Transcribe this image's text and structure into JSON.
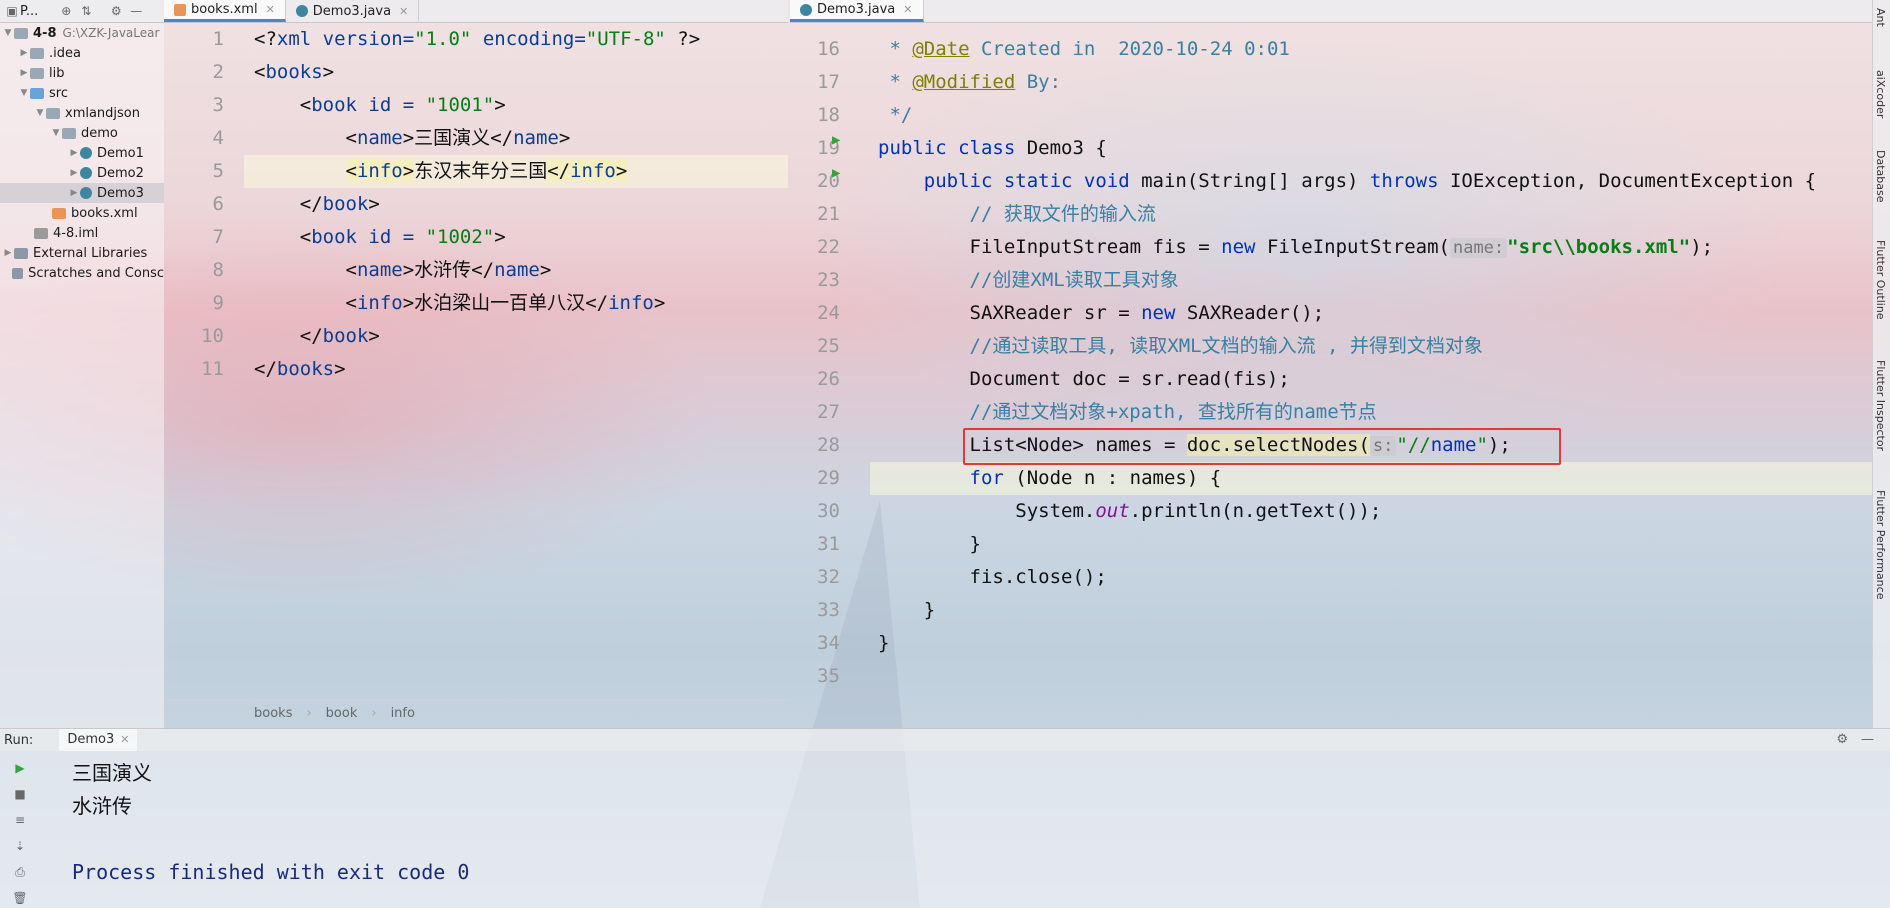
{
  "project": {
    "header_title": "P...",
    "items": [
      {
        "label": "4-8",
        "path": "G:\\XZK-JavaLear",
        "icon": "folder-icon",
        "bold": true
      },
      {
        "label": ".idea",
        "icon": "folder-icon"
      },
      {
        "label": "lib",
        "icon": "folder-icon"
      },
      {
        "label": "src",
        "icon": "folder-icon"
      },
      {
        "label": "xmlandjson",
        "icon": "package-icon"
      },
      {
        "label": "demo",
        "icon": "package-icon"
      },
      {
        "label": "Demo1",
        "icon": "java-class-icon"
      },
      {
        "label": "Demo2",
        "icon": "java-class-icon"
      },
      {
        "label": "Demo3",
        "icon": "java-class-icon"
      },
      {
        "label": "books.xml",
        "icon": "xml-file-icon"
      },
      {
        "label": "4-8.iml",
        "icon": "iml-file-icon"
      },
      {
        "label": "External Libraries",
        "icon": "library-icon"
      },
      {
        "label": "Scratches and Consc",
        "icon": "scratches-icon"
      }
    ]
  },
  "left_editor": {
    "tabs": [
      {
        "label": "books.xml"
      },
      {
        "label": "Demo3.java"
      }
    ],
    "line_numbers": [
      "1",
      "2",
      "3",
      "4",
      "5",
      "6",
      "7",
      "8",
      "9",
      "10",
      "11"
    ],
    "breadcrumbs": [
      "books",
      "book",
      "info"
    ]
  },
  "right_editor": {
    "tab": "Demo3.java",
    "line_numbers": [
      "16",
      "17",
      "18",
      "19",
      "20",
      "21",
      "22",
      "23",
      "24",
      "25",
      "26",
      "27",
      "28",
      "29",
      "30",
      "31",
      "32",
      "33",
      "34",
      "35"
    ]
  },
  "xml": {
    "decl_open": "<?",
    "decl_tag": "xml",
    "decl_a1": " version=",
    "decl_v1": "\"1.0\"",
    "decl_a2": " encoding=",
    "decl_v2": "\"UTF-8\"",
    "decl_close": " ?>",
    "books_open": "books",
    "book1_attr": " id = ",
    "book1_id": "\"1001\"",
    "name1": "三国演义",
    "info1": "东汉末年分三国",
    "book2_id": "\"1002\"",
    "name2": "水浒传",
    "info2": "水泊梁山一百单八汉",
    "name_tag": "name",
    "info_tag": "info",
    "book_tag": "book"
  },
  "java": {
    "l16a": " * ",
    "l16b": "@Date",
    "l16c": " Created in  2020-10-24 0:01",
    "l17a": " * ",
    "l17b": "@Modified",
    "l17c": " By:",
    "l18": " */",
    "l19a": "public class ",
    "l19b": "Demo3 {",
    "l20a": "    public static void ",
    "l20b": "main(String[] args) ",
    "l20c": "throws ",
    "l20d": "IOException, DocumentException {",
    "l21": "        // 获取文件的输入流",
    "l22a": "        FileInputStream fis = ",
    "l22b": "new ",
    "l22c": "FileInputStream(",
    "l22hint": "name:",
    "l22d": "\"src\\\\books.xml\"",
    "l22e": ");",
    "l23": "        //创建XML读取工具对象",
    "l24a": "        SAXReader sr = ",
    "l24b": "new ",
    "l24c": "SAXReader();",
    "l25": "        //通过读取工具, 读取XML文档的输入流 , 并得到文档对象",
    "l26": "        Document doc = sr.read(fis);",
    "l27": "        //通过文档对象+xpath, 查找所有的name节点",
    "l28a": "        List<Node> names = ",
    "l28b": "doc.selectNodes(",
    "l28hint": "s:",
    "l28c": "\"//",
    "l28d": "name",
    "l28e": "\"",
    ");": "",
    "l28f": ");",
    "l29a": "        ",
    "l29b": "for",
    " l29c": "",
    "l29c": " (Node n : names) {",
    "l30a": "            System.",
    "l30b": "out",
    "l30c": ".println(n.getText());",
    "l31": "        }",
    "l32": "        fis.close();",
    "l33": "    }",
    "l34": "}"
  },
  "run": {
    "label": "Run:",
    "tab": "Demo3",
    "output": [
      "三国演义",
      "水浒传",
      "",
      "Process finished with exit code 0"
    ]
  },
  "right_sidebar": [
    "Ant",
    "aiXcoder",
    "Database",
    "Flutter Outline",
    "Flutter Inspector",
    "Flutter Performance"
  ]
}
